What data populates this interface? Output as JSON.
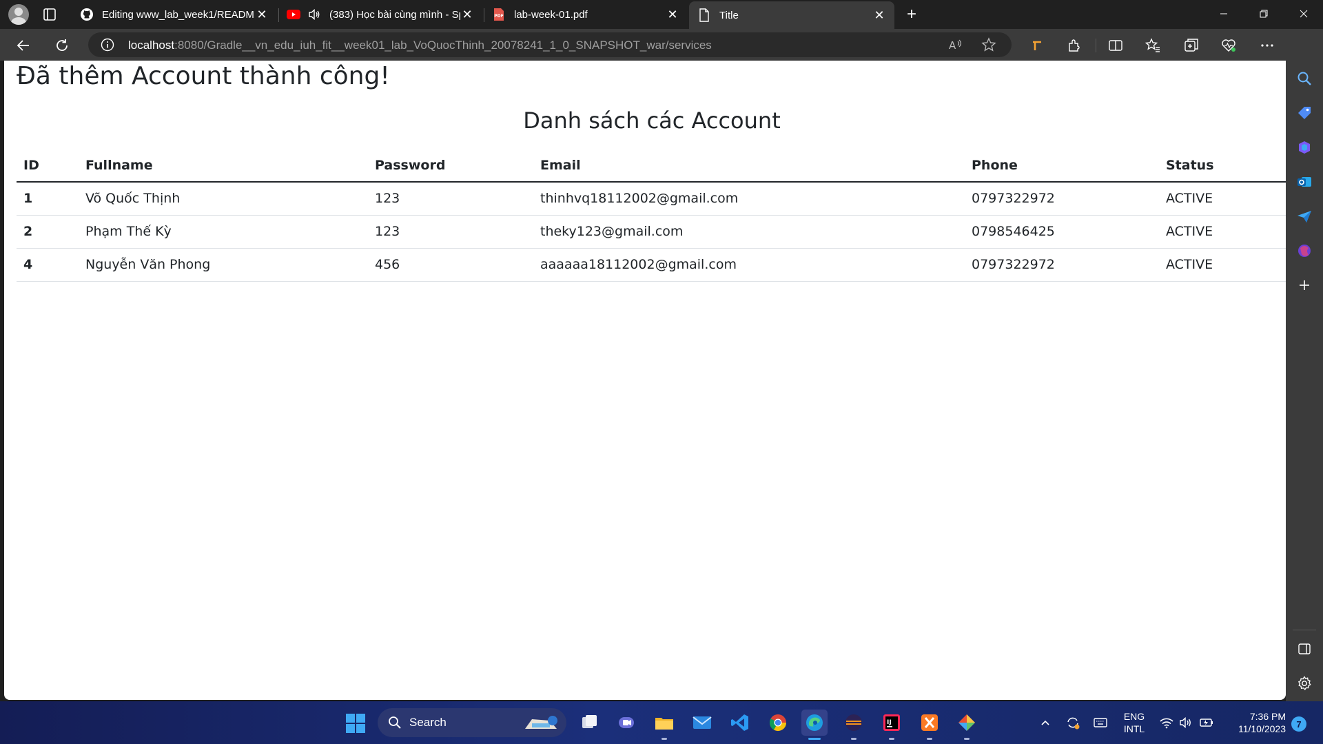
{
  "browser": {
    "tabs": [
      {
        "title": "Editing www_lab_week1/README.md",
        "icon": "github-icon"
      },
      {
        "title": "(383) Học bài cùng mình - Sp...",
        "icon": "youtube-icon"
      },
      {
        "title": "lab-week-01.pdf",
        "icon": "pdf-icon"
      },
      {
        "title": "Title",
        "icon": "page-icon",
        "active": true
      }
    ],
    "url": {
      "host": "localhost",
      "rest": ":8080/Gradle__vn_edu_iuh_fit__week01_lab_VoQuocThinh_20078241_1_0_SNAPSHOT_war/services"
    }
  },
  "page": {
    "success_message": "Đã thêm Account thành công!",
    "list_title": "Danh sách các Account",
    "table": {
      "headers": [
        "ID",
        "Fullname",
        "Password",
        "Email",
        "Phone",
        "Status"
      ],
      "rows": [
        [
          "1",
          "Võ Quốc Thịnh",
          "123",
          "thinhvq18112002@gmail.com",
          "0797322972",
          "ACTIVE"
        ],
        [
          "2",
          "Phạm Thế Kỳ",
          "123",
          "theky123@gmail.com",
          "0798546425",
          "ACTIVE"
        ],
        [
          "4",
          "Nguyễn Văn Phong",
          "456",
          "aaaaaa18112002@gmail.com",
          "0797322972",
          "ACTIVE"
        ]
      ]
    }
  },
  "taskbar": {
    "search_label": "Search",
    "language": "ENG",
    "layout": "INTL",
    "time": "7:36 PM",
    "date": "11/10/2023",
    "notifications": "7"
  },
  "colors": {
    "accent": "#3fa9f5",
    "chrome_dark": "#202020",
    "chrome_mid": "#3b3b3b",
    "youtube": "#ff0000",
    "pdf": "#e2574c"
  }
}
